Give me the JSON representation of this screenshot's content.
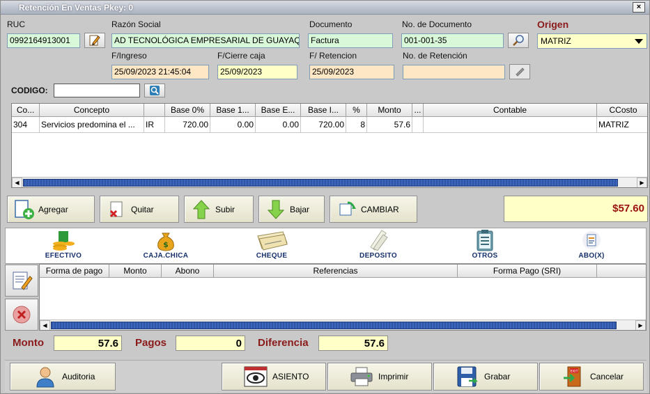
{
  "window": {
    "title": "Retención En Ventas Pkey: 0",
    "close": "×"
  },
  "header": {
    "ruc_label": "RUC",
    "ruc": "0992164913001",
    "razon_label": "Razón Social",
    "razon": "AD TECNOLÓGICA EMPRESARIAL DE GUAYAQUIL",
    "documento_label": "Documento",
    "documento": "Factura",
    "nodoc_label": "No. de Documento",
    "nodoc": "001-001-35",
    "origen_label": "Origen",
    "origen": "MATRIZ",
    "fingreso_label": "F/Ingreso",
    "fingreso": "25/09/2023 21:45:04",
    "fcierre_label": "F/Cierre caja",
    "fcierre": "25/09/2023",
    "fretencion_label": "F/ Retencion",
    "fretencion": "25/09/2023",
    "noret_label": "No. de Retención",
    "noret": "",
    "codigo_label": "CODIGO:",
    "codigo": ""
  },
  "grid": {
    "columns": [
      "Co...",
      "Concepto",
      "",
      "Base 0%",
      "Base 1...",
      "Base E...",
      "Base I...",
      "%",
      "Monto",
      "...",
      "Contable",
      "CCosto"
    ],
    "rows": [
      [
        "304",
        "Servicios predomina el ...",
        "IR",
        "720.00",
        "0.00",
        "0.00",
        "720.00",
        "8",
        "57.6",
        "",
        "",
        "MATRIZ"
      ]
    ]
  },
  "actions": {
    "agregar": "Agregar",
    "quitar": "Quitar",
    "subir": "Subir",
    "bajar": "Bajar",
    "cambiar": "CAMBIAR",
    "total": "$57.60"
  },
  "payments": {
    "types": [
      "EFECTIVO",
      "CAJA.CHICA",
      "CHEQUE",
      "DEPOSITO",
      "OTROS",
      "ABO(X)"
    ],
    "columns": [
      "Forma de pago",
      "Monto",
      "Abono",
      "Referencias",
      "Forma Pago (SRI)",
      ""
    ]
  },
  "summary": {
    "monto_label": "Monto",
    "monto": "57.6",
    "pagos_label": "Pagos",
    "pagos": "0",
    "diferencia_label": "Diferencia",
    "diferencia": "57.6"
  },
  "footer": {
    "auditoria": "Auditoria",
    "asiento": "ASIENTO",
    "imprimir": "Imprimir",
    "grabar": "Grabar",
    "cancelar": "Cancelar"
  },
  "colors": {
    "total_red": "#9a1010",
    "label_red": "#8b1a1a",
    "scroll_blue": "#2f55a4",
    "field_yellow": "#ffffc8",
    "field_green": "#d9f7d9",
    "field_peach": "#fde7c4"
  }
}
